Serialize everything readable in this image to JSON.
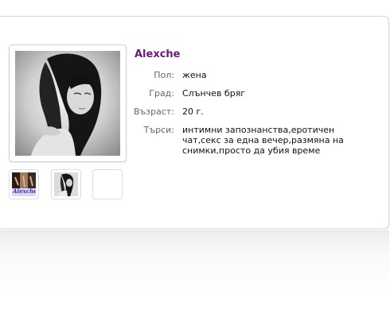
{
  "profile": {
    "name": "Alexche",
    "fields": [
      {
        "label": "Пол:",
        "value": "жена"
      },
      {
        "label": "Град:",
        "value": "Слънчев бряг"
      },
      {
        "label": "Възраст:",
        "value": "20 г."
      },
      {
        "label": "Търси:",
        "value": "интимни запознанства,еротичен чат,секс за една вечер,размяна на снимки,просто да убия време"
      }
    ],
    "thumb_text": "Alexche"
  },
  "colors": {
    "accent": "#6b1a7a",
    "label": "#666666",
    "text": "#111111"
  }
}
